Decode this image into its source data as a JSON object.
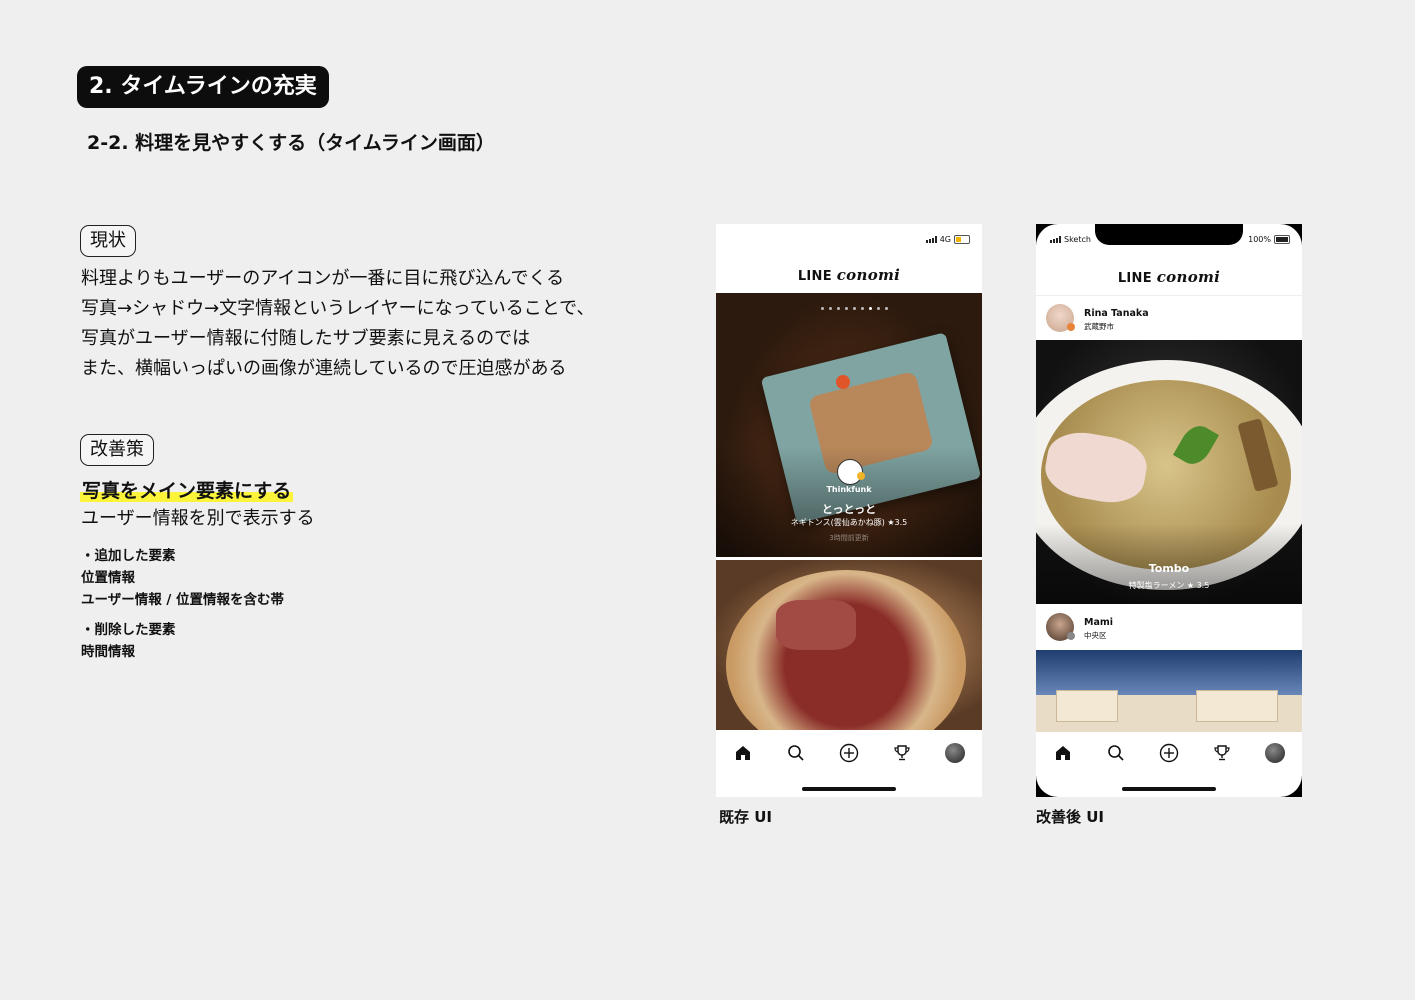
{
  "header": {
    "section_title": "2. タイムラインの充実",
    "subtitle": "2-2. 料理を見やすくする（タイムライン画面）"
  },
  "current": {
    "label": "現状",
    "lines": [
      "料理よりもユーザーのアイコンが一番に目に飛び込んでくる",
      "写真→シャドウ→文字情報というレイヤーになっていることで、",
      "写真がユーザー情報に付随したサブ要素に見えるのでは",
      "また、横幅いっぱいの画像が連続しているので圧迫感がある"
    ]
  },
  "improvement": {
    "label": "改善策",
    "highlight": "写真をメイン要素にする",
    "line": "ユーザー情報を別で表示する",
    "added_title": "・追加した要素",
    "added_items": [
      "位置情報",
      "ユーザー情報 / 位置情報を含む帯"
    ],
    "removed_title": "・削除した要素",
    "removed_items": [
      "時間情報"
    ]
  },
  "old_ui": {
    "caption": "既存 UI",
    "network": "4G",
    "logo_a": "LINE ",
    "logo_b": "conomi",
    "username": "Thinkfunk",
    "shop": "とっとっと",
    "dish": "ネギトンス(雲仙あかね豚) ★3.5",
    "time": "3時間前更新"
  },
  "new_ui": {
    "caption": "改善後 UI",
    "carrier": "Sketch",
    "battery": "100%",
    "logo_a": "LINE ",
    "logo_b": "conomi",
    "post1": {
      "name": "Rina Tanaka",
      "location": "武蔵野市",
      "shop": "Tombo",
      "dish": "特製塩ラーメン ★ 3.5"
    },
    "post2": {
      "name": "Mami",
      "location": "中央区"
    }
  },
  "icons": [
    "home-icon",
    "search-icon",
    "plus-circle-icon",
    "trophy-icon",
    "avatar"
  ],
  "colors": {
    "badge_bg": "#0d0d0d",
    "highlight": "#fbf43a",
    "page_bg": "#efefef"
  }
}
